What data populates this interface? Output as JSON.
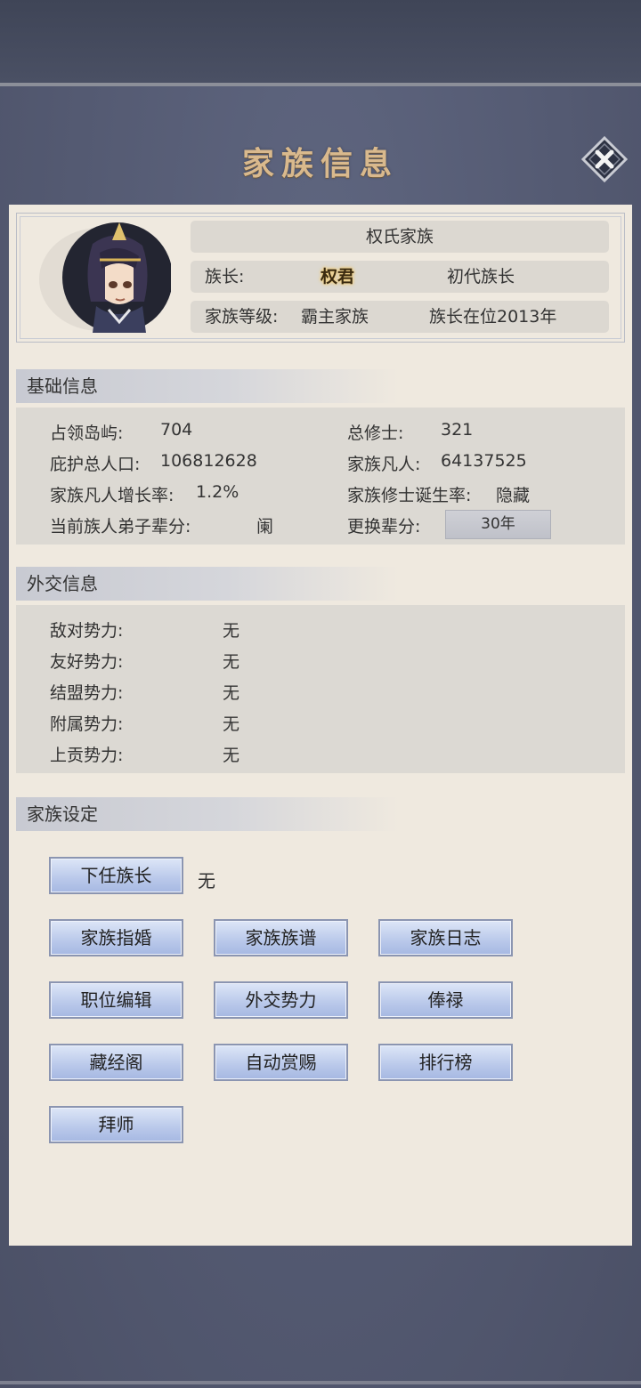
{
  "window": {
    "title": "家族信息"
  },
  "header": {
    "clan_name": "权氏家族",
    "leader_label": "族长:",
    "leader_name": "权君",
    "leader_generation": "初代族长",
    "level_label": "家族等级:",
    "level_value": "霸主家族",
    "tenure": "族长在位2013年"
  },
  "basic": {
    "title": "基础信息",
    "islands_label": "占领岛屿:",
    "islands_value": "704",
    "cultivators_label": "总修士:",
    "cultivators_value": "321",
    "population_label": "庇护总人口:",
    "population_value": "106812628",
    "mortals_label": "家族凡人:",
    "mortals_value": "64137525",
    "growth_label": "家族凡人增长率:",
    "growth_value": "1.2%",
    "birthrate_label": "家族修士诞生率:",
    "birthrate_value": "隐藏",
    "generation_label": "当前族人弟子辈分:",
    "generation_value": "阑",
    "switch_label": "更换辈分:",
    "switch_button": "30年"
  },
  "diplomacy": {
    "title": "外交信息",
    "rows": [
      {
        "label": "敌对势力:",
        "value": "无"
      },
      {
        "label": "友好势力:",
        "value": "无"
      },
      {
        "label": "结盟势力:",
        "value": "无"
      },
      {
        "label": "附属势力:",
        "value": "无"
      },
      {
        "label": "上贡势力:",
        "value": "无"
      }
    ]
  },
  "settings": {
    "title": "家族设定",
    "successor_button": "下任族长",
    "successor_value": "无",
    "buttons": [
      "家族指婚",
      "家族族谱",
      "家族日志",
      "职位编辑",
      "外交势力",
      "俸禄",
      "藏经阁",
      "自动赏赐",
      "排行榜",
      "拜师"
    ]
  },
  "colors": {
    "title_gold": "#d9b98d",
    "card_bg": "#efe9df",
    "button_blue": "#b9c8ea",
    "frame_bg": "#545a72"
  },
  "icons": [
    "close-icon",
    "avatar-portrait"
  ]
}
